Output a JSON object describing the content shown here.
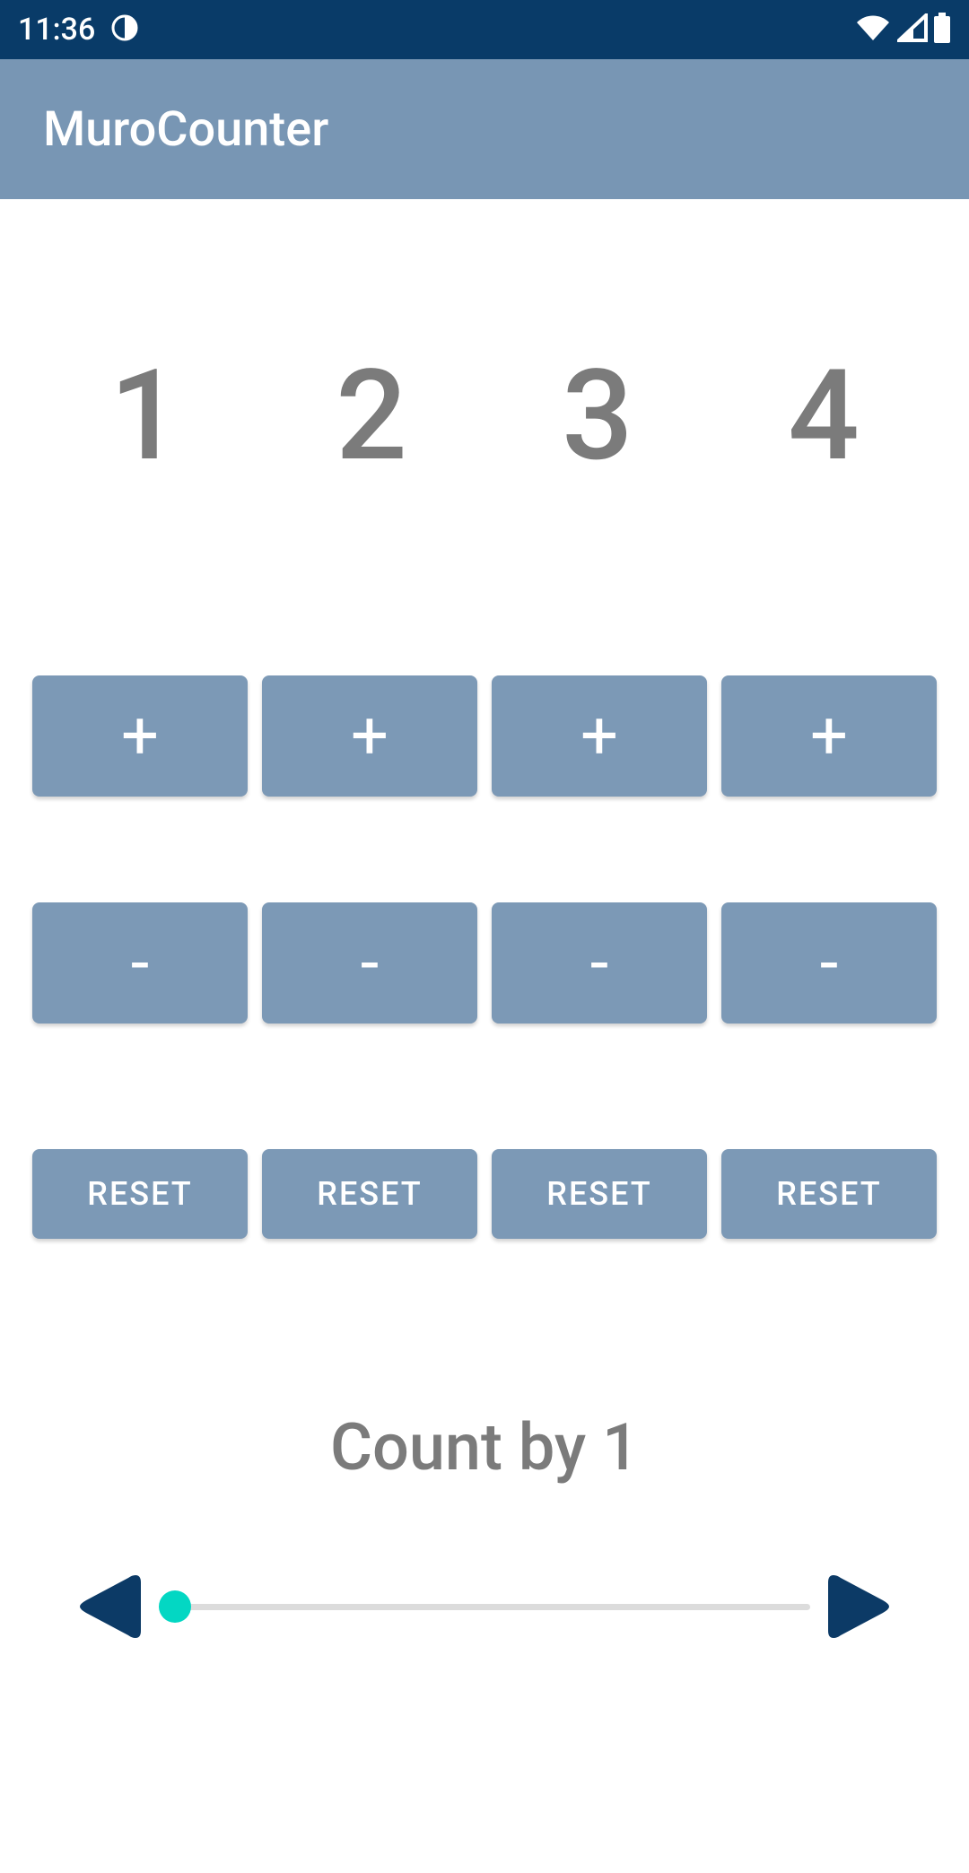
{
  "status": {
    "time": "11:36"
  },
  "app": {
    "title": "MuroCounter"
  },
  "counters": [
    "1",
    "2",
    "3",
    "4"
  ],
  "buttons": {
    "plus": "+",
    "minus": "-",
    "reset": "RESET"
  },
  "countBy": {
    "label": "Count by 1"
  }
}
